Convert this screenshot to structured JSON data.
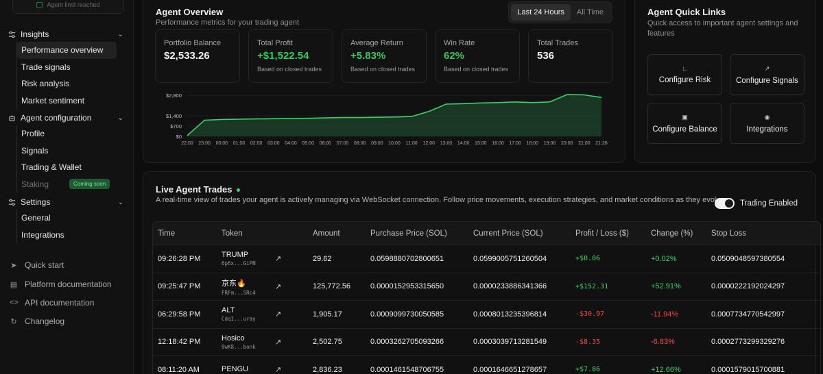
{
  "sidebar": {
    "limit_text": "Agent limit reached",
    "groups": [
      {
        "label": "Insights",
        "icon": "sliders-icon",
        "items": [
          "Performance overview",
          "Trade signals",
          "Risk analysis",
          "Market sentiment"
        ]
      },
      {
        "label": "Agent configuration",
        "icon": "robot-icon",
        "items": [
          "Profile",
          "Signals",
          "Trading & Wallet",
          "Staking"
        ]
      },
      {
        "label": "Settings",
        "icon": "sliders-icon",
        "items": [
          "General",
          "Integrations"
        ]
      }
    ],
    "staking_badge": "Coming soon",
    "footer": [
      {
        "label": "Quick start",
        "icon": "rocket-icon"
      },
      {
        "label": "Platform documentation",
        "icon": "book-icon"
      },
      {
        "label": "API documentation",
        "icon": "code-icon"
      },
      {
        "label": "Changelog",
        "icon": "history-icon"
      }
    ]
  },
  "overview": {
    "title": "Agent Overview",
    "subtitle": "Performance metrics for your trading agent",
    "range_options": [
      "Last 24 Hours",
      "All Time"
    ],
    "range_selected": "Last 24 Hours",
    "stats": [
      {
        "label": "Portfolio Balance",
        "value": "$2,533.26",
        "note": ""
      },
      {
        "label": "Total Profit",
        "value": "+$1,522.54",
        "note": "Based on closed trades"
      },
      {
        "label": "Average Return",
        "value": "+5.83%",
        "note": "Based on closed trades"
      },
      {
        "label": "Win Rate",
        "value": "62%",
        "note": "Based on closed trades"
      },
      {
        "label": "Total Trades",
        "value": "536",
        "note": ""
      }
    ]
  },
  "chart_data": {
    "type": "area",
    "x": [
      "22:00",
      "23:00",
      "00:00",
      "01:00",
      "02:00",
      "03:00",
      "04:00",
      "05:00",
      "06:00",
      "07:00",
      "08:00",
      "09:00",
      "10:00",
      "11:00",
      "12:00",
      "13:00",
      "14:00",
      "15:00",
      "16:00",
      "17:00",
      "18:00",
      "19:00",
      "20:00",
      "21:00",
      "21:28"
    ],
    "y": [
      50,
      1100,
      1150,
      1170,
      1190,
      1200,
      1210,
      1230,
      1260,
      1280,
      1280,
      1300,
      1320,
      1350,
      1700,
      2200,
      2230,
      2280,
      2300,
      2350,
      2300,
      2350,
      2850,
      2830,
      2650
    ],
    "y_ticks": [
      "$2,800",
      "$1,400",
      "$700",
      "$0"
    ],
    "ylim": [
      0,
      2900
    ],
    "line_color": "#3fcf6d",
    "grid": true
  },
  "quick_links": {
    "title": "Agent Quick Links",
    "subtitle": "Quick access to important agent settings and features",
    "buttons": [
      {
        "label": "Configure Risk",
        "icon": "line-chart-icon"
      },
      {
        "label": "Configure Signals",
        "icon": "trend-up-icon"
      },
      {
        "label": "Configure Balance",
        "icon": "wallet-icon"
      },
      {
        "label": "Integrations",
        "icon": "bot-icon"
      }
    ]
  },
  "trades": {
    "title": "Live Agent Trades",
    "subtitle": "A real-time view of trades your agent is actively managing via WebSocket connection. Follow price movements, execution strategies, and market conditions as they evolve.",
    "toggle_label": "Trading Enabled",
    "columns": [
      "Time",
      "Token",
      "Amount",
      "Purchase Price (SOL)",
      "Current Price (SOL)",
      "Profit / Loss ($)",
      "Change (%)",
      "Stop Loss"
    ],
    "rows": [
      {
        "time": "09:26:28 PM",
        "token": "TRUMP",
        "addr": "6p6x...GiPN",
        "amount": "29.62",
        "purchase": "0.0598880702800651",
        "current": "0.0599005751260504",
        "pl": "+$0.06",
        "change": "+0.02%",
        "stop": "0.0509048597380554",
        "dir": "pos"
      },
      {
        "time": "09:25:47 PM",
        "token": "京东🔥",
        "addr": "FRFm...5Rc4",
        "amount": "125,772.56",
        "purchase": "0.0000152953315650",
        "current": "0.0000233886341366",
        "pl": "+$152.31",
        "change": "+52.91%",
        "stop": "0.0000222192024297",
        "dir": "pos"
      },
      {
        "time": "06:29:58 PM",
        "token": "ALT",
        "addr": "Cdq1...uray",
        "amount": "1,905.17",
        "purchase": "0.0009099730050585",
        "current": "0.0008013235396814",
        "pl": "-$30.97",
        "change": "-11.94%",
        "stop": "0.0007734770542997",
        "dir": "neg"
      },
      {
        "time": "12:18:42 PM",
        "token": "Hosico",
        "addr": "9wK8...bonk",
        "amount": "2,502.75",
        "purchase": "0.0003262705093266",
        "current": "0.0003039713281549",
        "pl": "-$8.35",
        "change": "-6.83%",
        "stop": "0.0002773299329276",
        "dir": "neg"
      },
      {
        "time": "08:11:20 AM",
        "token": "PENGU",
        "addr": "",
        "amount": "2,836.23",
        "purchase": "0.0001461548706755",
        "current": "0.0001646651278657",
        "pl": "+$7.86",
        "change": "+12.66%",
        "stop": "0.0001579015700881",
        "dir": "pos"
      }
    ]
  }
}
